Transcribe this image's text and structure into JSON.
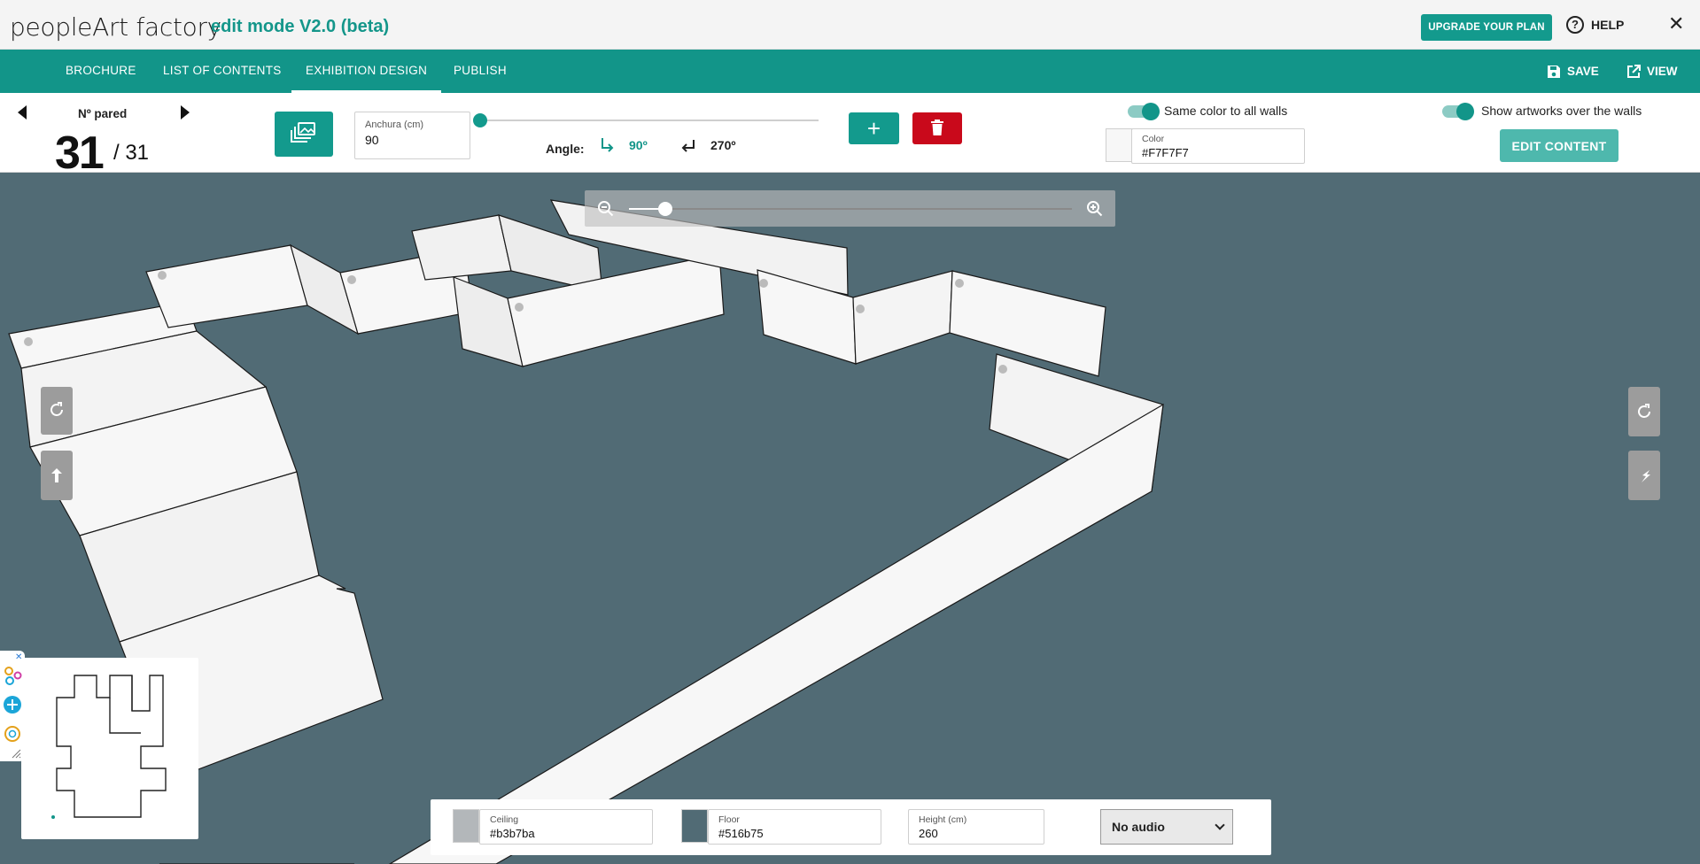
{
  "header": {
    "brand": "peopleArt factory",
    "mode": "edit mode V2.0 (beta)",
    "upgrade_label": "UPGRADE YOUR PLAN",
    "help_label": "HELP",
    "help_glyph": "?",
    "close_glyph": "✕"
  },
  "nav": {
    "tabs": [
      {
        "label": "BROCHURE"
      },
      {
        "label": "LIST OF CONTENTS"
      },
      {
        "label": "EXHIBITION DESIGN",
        "active": true
      },
      {
        "label": "PUBLISH"
      }
    ],
    "save_label": "SAVE",
    "view_label": "VIEW"
  },
  "toolbar": {
    "wall_label": "Nº pared",
    "wall_current": "31",
    "wall_total": "/ 31",
    "width": {
      "label": "Anchura (cm)",
      "value": "90"
    },
    "width_slider_fraction": 0.0,
    "angle_label": "Angle:",
    "angle_a": "90º",
    "angle_b": "270º",
    "add_glyph": "+",
    "same_color_label": "Same color to all walls",
    "show_artworks_label": "Show artworks over the walls",
    "color": {
      "label": "Color",
      "value": "#F7F7F7"
    },
    "edit_content_label": "EDIT CONTENT"
  },
  "zoom": {
    "level_fraction": 0.08
  },
  "bottom": {
    "ceiling": {
      "label": "Ceiling",
      "value": "#b3b7ba"
    },
    "floor": {
      "label": "Floor",
      "value": "#516b75"
    },
    "height": {
      "label": "Height (cm)",
      "value": "260"
    },
    "audio_selected": "No audio"
  },
  "colors": {
    "accent": "#129589",
    "delete": "#c9091b",
    "scene_floor": "#516b75",
    "wall": "#f7f7f7",
    "ceiling": "#b3b7ba"
  },
  "icons": [
    "gallery-icon",
    "trash-icon",
    "save-icon",
    "external-link-icon",
    "zoom-out-icon",
    "zoom-in-icon",
    "rotate-icon",
    "turn-arrow-icon"
  ]
}
